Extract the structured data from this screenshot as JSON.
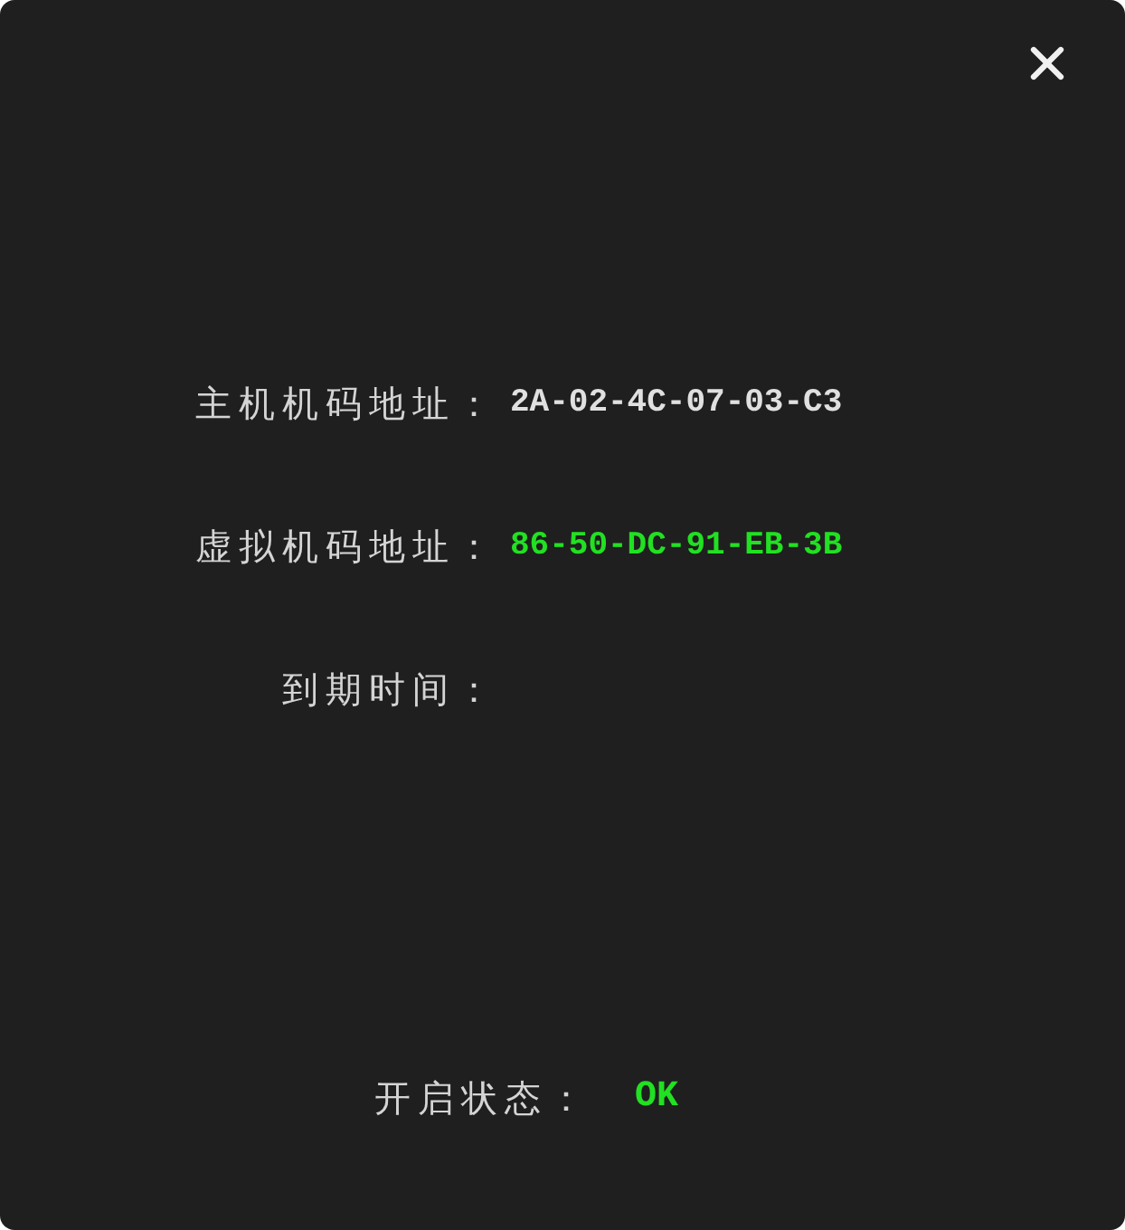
{
  "fields": [
    {
      "label": "主机机码地址：",
      "value": "2A-02-4C-07-03-C3",
      "color": "#e0e0e0"
    },
    {
      "label": "虚拟机码地址：",
      "value": "86-50-DC-91-EB-3B",
      "color": "#22e022"
    },
    {
      "label": "到期时间："
    }
  ],
  "status": {
    "label": "开启状态：",
    "value": "OK",
    "color": "#22e022"
  }
}
